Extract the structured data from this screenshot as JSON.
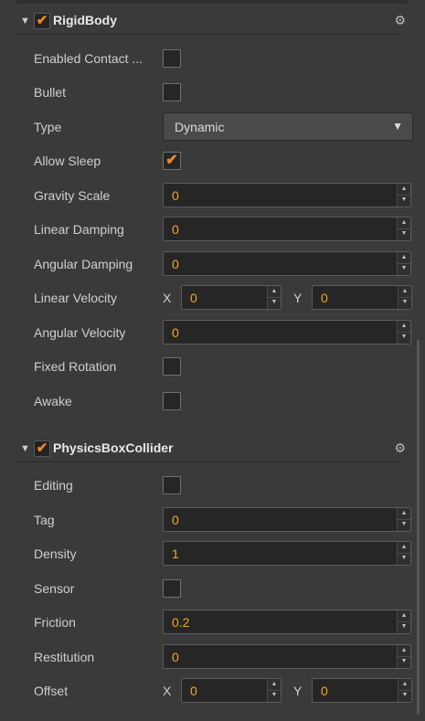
{
  "rigidbody": {
    "title": "RigidBody",
    "enabled": true,
    "icons": {
      "collapse": "triangle-down-icon",
      "settings": "gear-icon"
    },
    "rows": {
      "enabled_contact": {
        "label": "Enabled Contact ...",
        "checked": false
      },
      "bullet": {
        "label": "Bullet",
        "checked": false
      },
      "type": {
        "label": "Type",
        "value": "Dynamic"
      },
      "allow_sleep": {
        "label": "Allow Sleep",
        "checked": true
      },
      "gravity_scale": {
        "label": "Gravity Scale",
        "value": "0"
      },
      "linear_damping": {
        "label": "Linear Damping",
        "value": "0"
      },
      "angular_damping": {
        "label": "Angular Damping",
        "value": "0"
      },
      "linear_velocity": {
        "label": "Linear Velocity",
        "x_label": "X",
        "x": "0",
        "y_label": "Y",
        "y": "0"
      },
      "angular_velocity": {
        "label": "Angular Velocity",
        "value": "0"
      },
      "fixed_rotation": {
        "label": "Fixed Rotation",
        "checked": false
      },
      "awake": {
        "label": "Awake",
        "checked": false
      }
    }
  },
  "box_collider": {
    "title": "PhysicsBoxCollider",
    "enabled": true,
    "rows": {
      "editing": {
        "label": "Editing",
        "checked": false
      },
      "tag": {
        "label": "Tag",
        "value": "0"
      },
      "density": {
        "label": "Density",
        "value": "1"
      },
      "sensor": {
        "label": "Sensor",
        "checked": false
      },
      "friction": {
        "label": "Friction",
        "value": "0.2"
      },
      "restitution": {
        "label": "Restitution",
        "value": "0"
      },
      "offset": {
        "label": "Offset",
        "x_label": "X",
        "x": "0",
        "y_label": "Y",
        "y": "0"
      }
    }
  },
  "glyphs": {
    "arrow": "▼",
    "check": "✔",
    "gear": "⚙",
    "up": "▲",
    "down": "▼",
    "caret": "▼"
  },
  "colors": {
    "accent": "#f08a24",
    "value": "#f5a623",
    "panel": "#3a3a3a",
    "field": "#262626"
  }
}
